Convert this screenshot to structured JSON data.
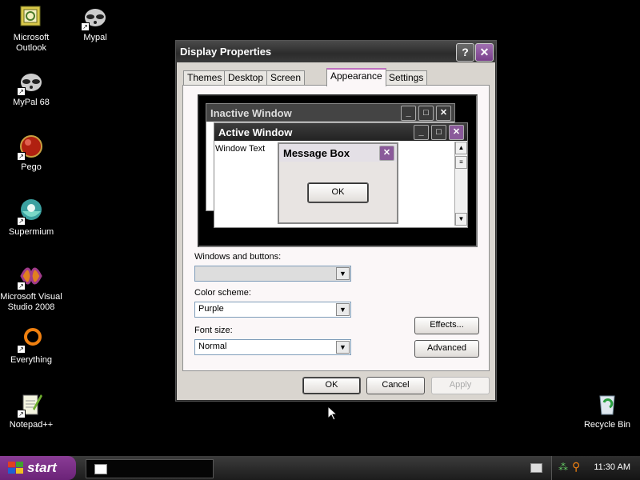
{
  "desktop": {
    "icons": [
      {
        "label": "Microsoft Outlook"
      },
      {
        "label": "Mypal"
      },
      {
        "label": "MyPal 68"
      },
      {
        "label": "Pego"
      },
      {
        "label": "Supermium"
      },
      {
        "label": "Microsoft Visual Studio 2008"
      },
      {
        "label": "Everything"
      },
      {
        "label": "Notepad++"
      },
      {
        "label": "Recycle Bin"
      }
    ]
  },
  "dialog": {
    "title": "Display Properties",
    "help_glyph": "?",
    "close_glyph": "✕",
    "tabs": [
      "Themes",
      "Desktop",
      "Screen Saver",
      "Appearance",
      "Settings"
    ],
    "active_tab": "Appearance",
    "preview": {
      "inactive_title": "Inactive Window",
      "active_title": "Active Window",
      "window_text": "Window Text",
      "message_title": "Message Box",
      "ok": "OK"
    },
    "windows_buttons_label": "Windows and buttons:",
    "windows_buttons_value": "",
    "color_scheme_label": "Color scheme:",
    "color_scheme_value": "Purple",
    "font_size_label": "Font size:",
    "font_size_value": "Normal",
    "effects_button": "Effects...",
    "advanced_button": "Advanced",
    "ok_button": "OK",
    "cancel_button": "Cancel",
    "apply_button": "Apply"
  },
  "taskbar": {
    "start_label": "start",
    "clock": "11:30 AM"
  },
  "colors": {
    "accent_purple": "#7a3f8c",
    "desktop_bg": "#000000"
  }
}
